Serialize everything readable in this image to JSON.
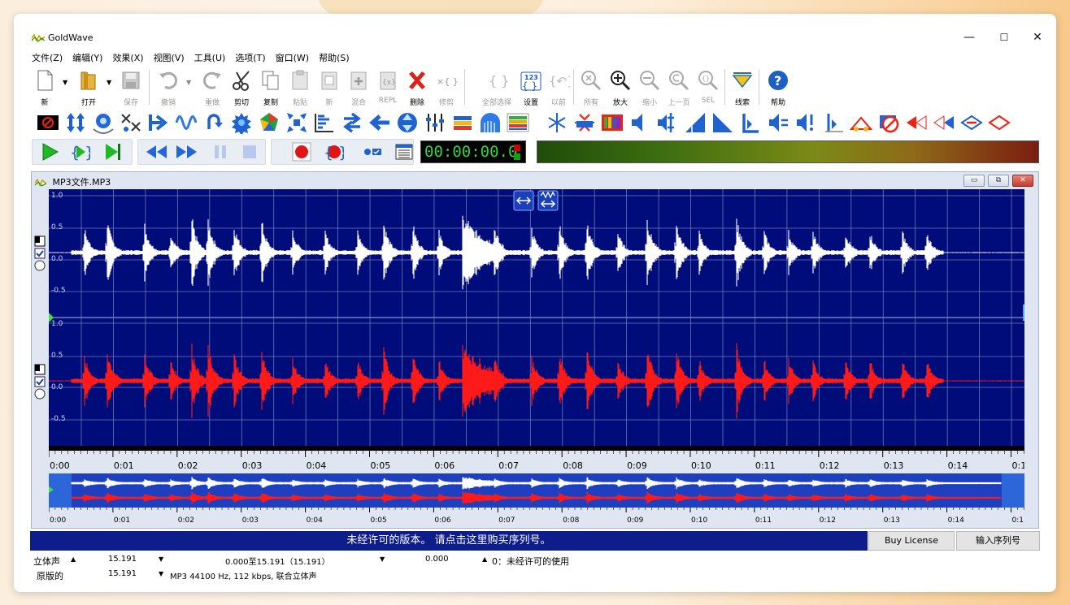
{
  "window": {
    "title": "GoldWave",
    "controls": {
      "minimize": "—",
      "maximize": "☐",
      "close": "✕"
    }
  },
  "menu": [
    "文件(Z)",
    "编辑(Y)",
    "效果(X)",
    "视图(V)",
    "工具(U)",
    "选项(T)",
    "窗口(W)",
    "帮助(S)"
  ],
  "toolbar": [
    {
      "label": "新",
      "icon": "new-file-icon",
      "enabled": true
    },
    {
      "label": "打开",
      "icon": "open-folder-icon",
      "enabled": true
    },
    {
      "label": "保存",
      "icon": "save-icon",
      "enabled": false
    },
    {
      "label": "撤销",
      "icon": "undo-icon",
      "enabled": false
    },
    {
      "label": "重做",
      "icon": "redo-icon",
      "enabled": false
    },
    {
      "label": "剪切",
      "icon": "scissors-icon",
      "enabled": true
    },
    {
      "label": "复制",
      "icon": "copy-icon",
      "enabled": true
    },
    {
      "label": "粘贴",
      "icon": "paste-icon",
      "enabled": false
    },
    {
      "label": "新",
      "icon": "paste-new-icon",
      "enabled": false
    },
    {
      "label": "混合",
      "icon": "mix-icon",
      "enabled": false
    },
    {
      "label": "REPL",
      "icon": "replace-icon",
      "enabled": false
    },
    {
      "label": "删除",
      "icon": "delete-icon",
      "enabled": true
    },
    {
      "label": "修剪",
      "icon": "trim-icon",
      "enabled": false
    },
    {
      "label": "全部选择",
      "icon": "select-all-icon",
      "enabled": false
    },
    {
      "label": "设置",
      "icon": "set-marker-icon",
      "enabled": true
    },
    {
      "label": "以前",
      "icon": "previous-icon",
      "enabled": false
    },
    {
      "label": "所有",
      "icon": "zoom-all-icon",
      "enabled": false
    },
    {
      "label": "放大",
      "icon": "zoom-in-icon",
      "enabled": true
    },
    {
      "label": "缩小",
      "icon": "zoom-out-icon",
      "enabled": false
    },
    {
      "label": "上一页",
      "icon": "zoom-previous-icon",
      "enabled": false
    },
    {
      "label": "SEL",
      "icon": "zoom-selection-icon",
      "enabled": false
    },
    {
      "label": "线索",
      "icon": "cue-icon",
      "enabled": true
    },
    {
      "label": "帮助",
      "icon": "help-icon",
      "enabled": true
    }
  ],
  "transport": {
    "time": "00:00:00.0"
  },
  "document": {
    "title": "MP3文件.MP3",
    "amp_labels": [
      "1.0",
      "0.5",
      "0.0",
      "-0.5"
    ],
    "time_labels": [
      "0:00",
      "0:01",
      "0:02",
      "0:03",
      "0:04",
      "0:05",
      "0:06",
      "0:07",
      "0:08",
      "0:09",
      "0:10",
      "0:11",
      "0:12",
      "0:13",
      "0:14",
      "0:1"
    ],
    "channel_colors": {
      "left": "#ffffff",
      "right": "#ff1a1a",
      "background": "#000c7a"
    }
  },
  "banner": {
    "text": "未经许可的版本。 请点击这里购买序列号。",
    "buy_label": "Buy License",
    "serial_label": "输入序列号"
  },
  "status": {
    "row1": {
      "channels": "立体声",
      "length": "15.191",
      "selection": "0.000至15.191（15.191）",
      "position": "0.000",
      "message": "0：未经许可的使用"
    },
    "row2": {
      "label": "原版的",
      "length": "15.191",
      "format": "MP3 44100 Hz, 112 kbps, 联合立体声"
    }
  }
}
